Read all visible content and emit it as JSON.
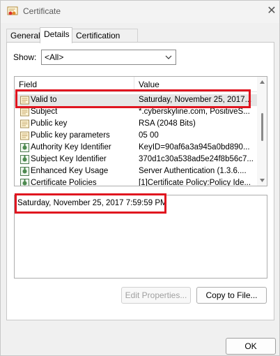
{
  "window": {
    "title": "Certificate",
    "close_glyph": "✕"
  },
  "tabs": [
    {
      "label": "General",
      "active": false
    },
    {
      "label": "Details",
      "active": true
    },
    {
      "label": "Certification Path",
      "active": false
    }
  ],
  "show": {
    "label": "Show:",
    "selected": "<All>"
  },
  "fields_list": {
    "columns": [
      "Field",
      "Value"
    ],
    "rows": [
      {
        "field": "Valid to",
        "value": "Saturday, November 25, 2017...",
        "icon": "certificate-field-icon",
        "selected": true
      },
      {
        "field": "Subject",
        "value": "*.cyberskyline.com, PositiveS...",
        "icon": "certificate-field-icon",
        "selected": false
      },
      {
        "field": "Public key",
        "value": "RSA (2048 Bits)",
        "icon": "certificate-field-icon",
        "selected": false
      },
      {
        "field": "Public key parameters",
        "value": "05 00",
        "icon": "certificate-field-icon",
        "selected": false
      },
      {
        "field": "Authority Key Identifier",
        "value": "KeyID=90af6a3a945a0bd890...",
        "icon": "extension-icon",
        "selected": false
      },
      {
        "field": "Subject Key Identifier",
        "value": "370d1c30a538ad5e24f8b56c7...",
        "icon": "extension-icon",
        "selected": false
      },
      {
        "field": "Enhanced Key Usage",
        "value": "Server Authentication (1.3.6....",
        "icon": "extension-icon",
        "selected": false
      },
      {
        "field": "Certificate Policies",
        "value": "[1]Certificate Policy:Policy Ide...",
        "icon": "extension-icon",
        "selected": false
      }
    ]
  },
  "detail": {
    "text": "Saturday, November 25, 2017 7:59:59 PM"
  },
  "buttons": {
    "edit_properties": "Edit Properties...",
    "copy_to_file": "Copy to File...",
    "ok": "OK"
  },
  "colors": {
    "highlight_box": "#e0141f",
    "selected_row": "#e6e6e6"
  }
}
